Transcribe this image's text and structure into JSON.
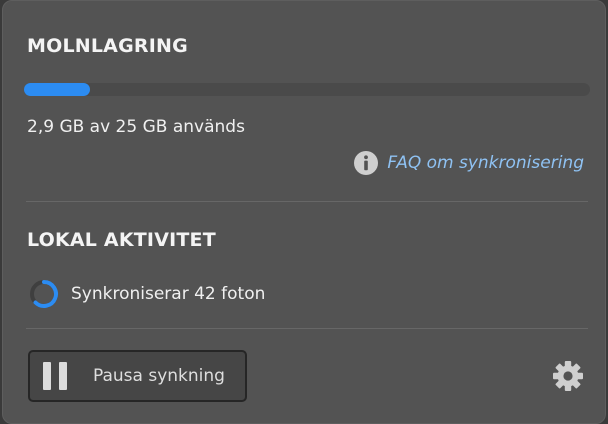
{
  "cloud_storage": {
    "title": "MOLNLAGRING",
    "usage_text": "2,9 GB av 25 GB används",
    "used_fraction": 0.116,
    "faq_link": "FAQ om synkronisering",
    "faq_icon": "info-icon"
  },
  "local_activity": {
    "title": "LOKAL AKTIVITET",
    "sync_status": "Synkroniserar 42 foton",
    "status_icon": "spinner-icon"
  },
  "footer": {
    "pause_label": "Pausa synkning",
    "pause_icon": "pause-icon",
    "settings_icon": "gear-icon"
  },
  "colors": {
    "accent": "#2c8cf2",
    "link": "#8fc2f3",
    "panel_bg": "#535353"
  }
}
